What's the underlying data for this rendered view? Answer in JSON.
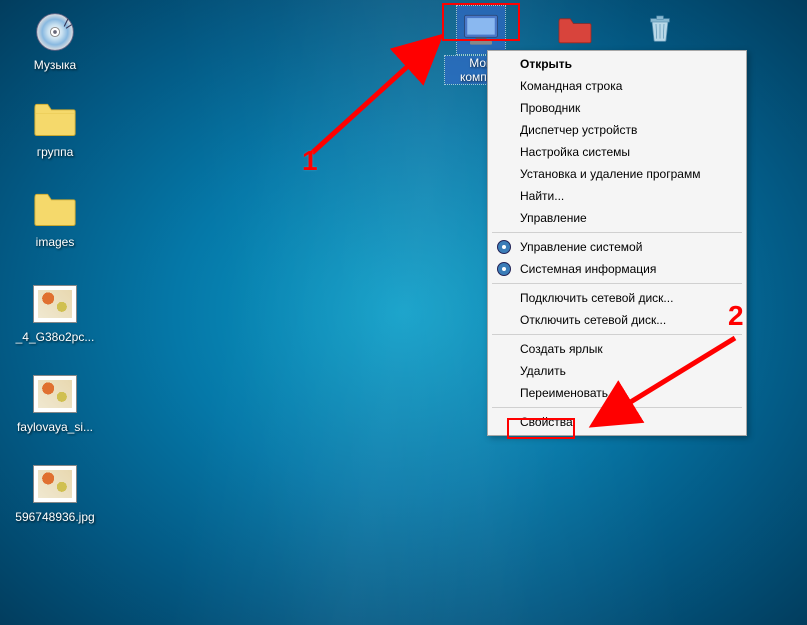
{
  "desktop": {
    "icons": [
      {
        "label": "Музыка",
        "type": "cd"
      },
      {
        "label": "группа",
        "type": "folder"
      },
      {
        "label": "images",
        "type": "folder"
      },
      {
        "label": "_4_G38o2pc...",
        "type": "image"
      },
      {
        "label": "faylovaya_si...",
        "type": "image"
      },
      {
        "label": "596748936.jpg",
        "type": "image"
      }
    ],
    "top_icons": {
      "computer": "Мой компью",
      "red_folder": "",
      "recycle": ""
    }
  },
  "context_menu": {
    "items": [
      {
        "label": "Открыть",
        "bold": true
      },
      {
        "label": "Командная строка"
      },
      {
        "label": "Проводник"
      },
      {
        "label": "Диспетчер устройств"
      },
      {
        "label": "Настройка системы"
      },
      {
        "label": "Установка и удаление программ"
      },
      {
        "label": "Найти..."
      },
      {
        "label": "Управление"
      },
      {
        "sep": true
      },
      {
        "label": "Управление системой",
        "icon": "disc"
      },
      {
        "label": "Системная информация",
        "icon": "disc"
      },
      {
        "sep": true
      },
      {
        "label": "Подключить сетевой диск..."
      },
      {
        "label": "Отключить сетевой диск..."
      },
      {
        "sep": true
      },
      {
        "label": "Создать ярлык"
      },
      {
        "label": "Удалить"
      },
      {
        "label": "Переименовать"
      },
      {
        "sep": true
      },
      {
        "label": "Свойства"
      }
    ]
  },
  "annotations": {
    "one": "1",
    "two": "2"
  }
}
